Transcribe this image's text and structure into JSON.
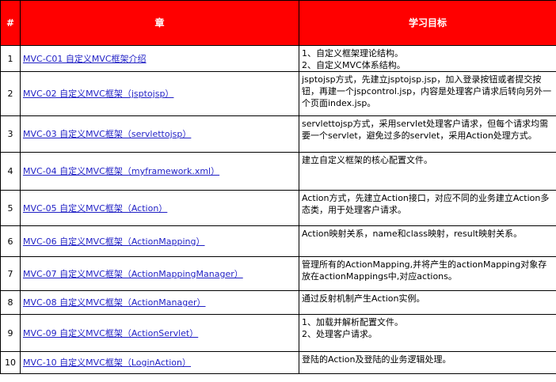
{
  "colors": {
    "header_bg": "#ff0000",
    "header_text": "#ffffff",
    "link": "#1f1fc5"
  },
  "headers": {
    "num": "#",
    "chapter": "章",
    "goal": "学习目标"
  },
  "rows": [
    {
      "num": "1",
      "chapter": "MVC-C01 自定义MVC框架介绍",
      "goal": "1、自定义框架理论结构。\n2、自定义MVC体系结构。"
    },
    {
      "num": "2",
      "chapter": "MVC-02 自定义MVC框架（jsptojsp）",
      "goal": "jsptojsp方式，先建立jsptojsp.jsp，加入登录按钮或者提交按钮，再建一个jspcontrol.jsp，内容是处理客户请求后转向另外一个页面index.jsp。"
    },
    {
      "num": "3",
      "chapter": "MVC-03 自定义MVC框架（servlettojsp）",
      "goal": "servlettojsp方式，采用servlet处理客户请求，但每个请求均需要一个servlet，避免过多的servlet，采用Action处理方式。"
    },
    {
      "num": "4",
      "chapter": "MVC-04 自定义MVC框架（myframework.xml）",
      "goal": "建立自定义框架的核心配置文件。"
    },
    {
      "num": "5",
      "chapter": "MVC-05 自定义MVC框架（Action）",
      "goal": "Action方式，先建立Action接口，对应不同的业务建立Action多态类，用于处理客户请求。"
    },
    {
      "num": "6",
      "chapter": "MVC-06 自定义MVC框架（ActionMapping）",
      "goal": "Action映射关系，name和class映射，result映射关系。"
    },
    {
      "num": "7",
      "chapter": "MVC-07 自定义MVC框架（ActionMappingManager）",
      "goal": "管理所有的ActionMapping,并将产生的actionMapping对象存放在actionMappings中,对应actions。"
    },
    {
      "num": "8",
      "chapter": "MVC-08 自定义MVC框架（ActionManager）",
      "goal": "通过反射机制产生Action实例。"
    },
    {
      "num": "9",
      "chapter": "MVC-09 自定义MVC框架（ActionServlet）",
      "goal": "1、加载并解析配置文件。\n2、处理客户请求。"
    },
    {
      "num": "10",
      "chapter": "MVC-10 自定义MVC框架（LoginAction）",
      "goal": "登陆的Action及登陆的业务逻辑处理。"
    }
  ]
}
